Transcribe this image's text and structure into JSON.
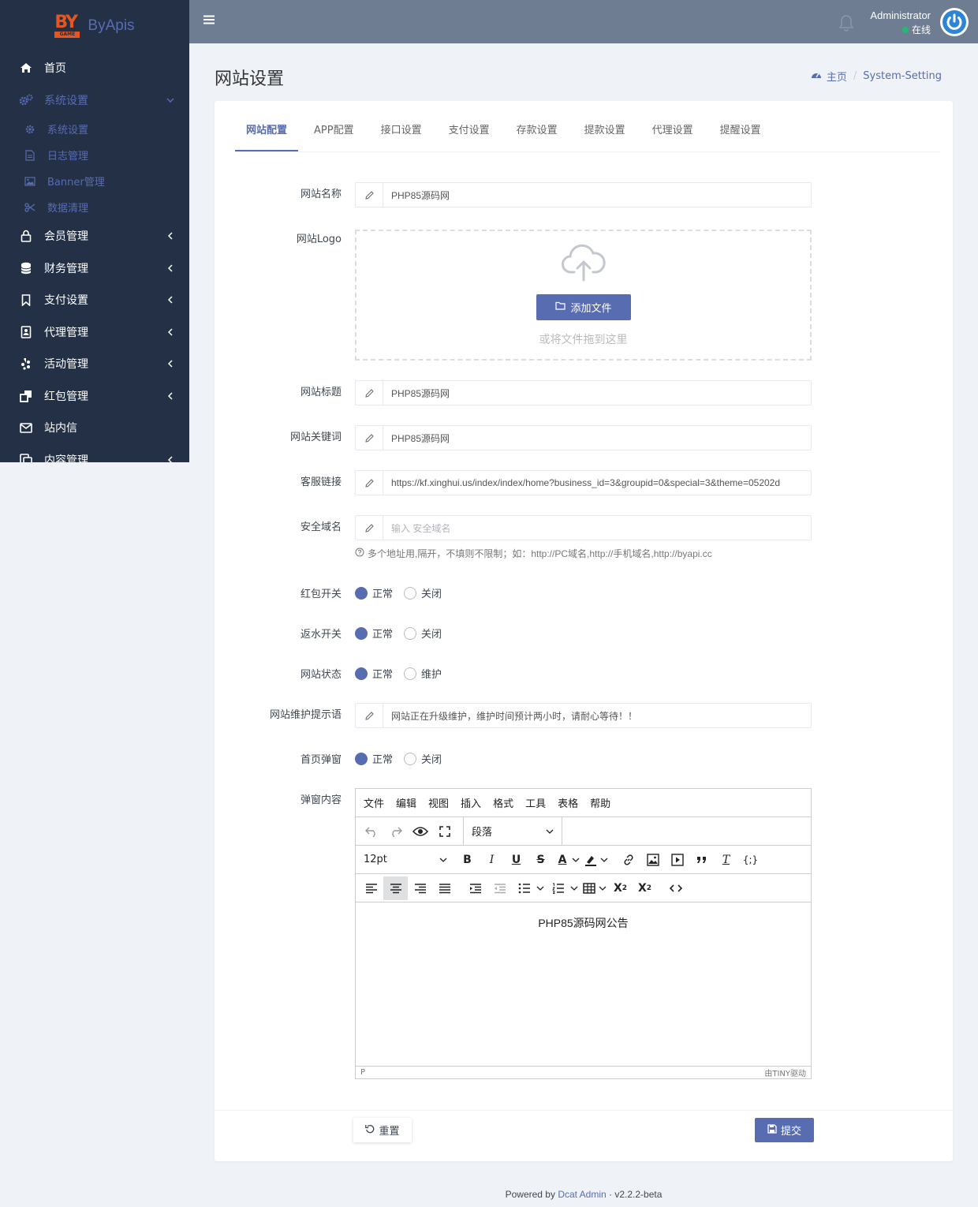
{
  "brand": {
    "name": "ByApis",
    "logo_text": "BY",
    "logo_sub": "GAME"
  },
  "sidebar": {
    "items": [
      {
        "label": "首页",
        "icon": "home-icon"
      },
      {
        "label": "系统设置",
        "icon": "gears-icon",
        "active": true
      },
      {
        "label": "会员管理",
        "icon": "lock-icon"
      },
      {
        "label": "财务管理",
        "icon": "database-icon"
      },
      {
        "label": "支付设置",
        "icon": "bookmark-icon"
      },
      {
        "label": "代理管理",
        "icon": "contact-book-icon"
      },
      {
        "label": "活动管理",
        "icon": "yelp-icon"
      },
      {
        "label": "红包管理",
        "icon": "clone-icon"
      },
      {
        "label": "站内信",
        "icon": "envelope-icon"
      },
      {
        "label": "内容管理",
        "icon": "copy-icon"
      }
    ],
    "subitems": [
      {
        "label": "系统设置",
        "icon": "gear-icon"
      },
      {
        "label": "日志管理",
        "icon": "file-icon"
      },
      {
        "label": "Banner管理",
        "icon": "image-icon"
      },
      {
        "label": "数据清理",
        "icon": "scissors-icon"
      }
    ]
  },
  "header": {
    "user_name": "Administrator",
    "user_status": "在线"
  },
  "page": {
    "title": "网站设置",
    "breadcrumb_home": "主页",
    "breadcrumb_current": "System-Setting"
  },
  "tabs": [
    "网站配置",
    "APP配置",
    "接口设置",
    "支付设置",
    "存款设置",
    "提款设置",
    "代理设置",
    "提醒设置"
  ],
  "form": {
    "site_name_label": "网站名称",
    "site_name": "PHP85源码网",
    "logo_label": "网站Logo",
    "upload_button": "添加文件",
    "upload_hint": "或将文件拖到这里",
    "site_title_label": "网站标题",
    "site_title": "PHP85源码网",
    "keywords_label": "网站关键词",
    "keywords": "PHP85源码网",
    "service_label": "客服链接",
    "service_link": "https://kf.xinghui.us/index/index/home?business_id=3&groupid=0&special=3&theme=05202d",
    "domain_label": "安全域名",
    "domain_placeholder": "输入 安全域名",
    "domain_help": "多个地址用,隔开，不填则不限制；如：http://PC域名,http://手机域名,http://byapi.cc",
    "redpack_label": "红包开关",
    "rebate_label": "返水开关",
    "status_label": "网站状态",
    "maint_label": "网站维护提示语",
    "maint_text": "网站正在升级维护，维护时间预计两小时，请耐心等待！！",
    "popup_label": "首页弹窗",
    "popup_content_label": "弹窗内容",
    "opt_normal": "正常",
    "opt_close": "关闭",
    "opt_maint": "维护",
    "reset_button": "重置",
    "submit_button": "提交"
  },
  "editor": {
    "menus": [
      "文件",
      "编辑",
      "视图",
      "插入",
      "格式",
      "工具",
      "表格",
      "帮助"
    ],
    "block_format": "段落",
    "font_size": "12pt",
    "content": "PHP85源码网公告",
    "status_path": "P",
    "powered": "由TINY驱动"
  },
  "footer": {
    "prefix": "Powered by",
    "brand": "Dcat Admin",
    "dot": "·",
    "version": "v2.2.2-beta"
  },
  "colors": {
    "primary": "#586cb1",
    "sidebar": "#233046",
    "topbar": "#6f7d92",
    "online": "#21b978"
  }
}
